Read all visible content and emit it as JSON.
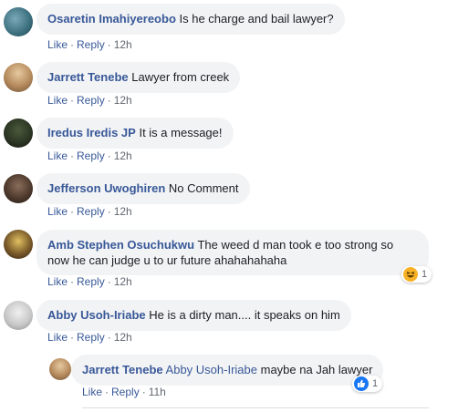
{
  "comments": [
    {
      "author": "Osaretin Imahiyereobo",
      "text": "Is he charge and bail lawyer?",
      "like": "Like",
      "reply": "Reply",
      "time": "12h"
    },
    {
      "author": "Jarrett Tenebe",
      "text": "Lawyer from creek",
      "like": "Like",
      "reply": "Reply",
      "time": "12h"
    },
    {
      "author": "Iredus Iredis JP",
      "text": "It is a message!",
      "like": "Like",
      "reply": "Reply",
      "time": "12h"
    },
    {
      "author": "Jefferson Uwoghiren",
      "text": "No Comment",
      "like": "Like",
      "reply": "Reply",
      "time": "12h"
    },
    {
      "author": "Amb Stephen Osuchukwu",
      "text": "The weed d man took e too strong so now he can judge u to ur future ahahahahaha",
      "like": "Like",
      "reply": "Reply",
      "time": "12h",
      "reaction_count": "1",
      "reaction_icon": "haha-emoji-icon"
    },
    {
      "author": "Abby Usoh-Iriabe",
      "text": "He is a dirty man.... it speaks on him",
      "like": "Like",
      "reply": "Reply",
      "time": "12h"
    }
  ],
  "reply": {
    "author": "Jarrett Tenebe",
    "mention": "Abby Usoh-Iriabe",
    "text": "maybe na Jah lawyer",
    "like": "Like",
    "reply": "Reply",
    "time": "11h",
    "reaction_count": "1",
    "reaction_icon": "like-thumb-icon"
  },
  "colors": {
    "author": "#385898",
    "bubble": "#f2f3f5",
    "meta": "#606770",
    "like_blue": "#1877f2",
    "haha_yellow": "#f7b125"
  }
}
